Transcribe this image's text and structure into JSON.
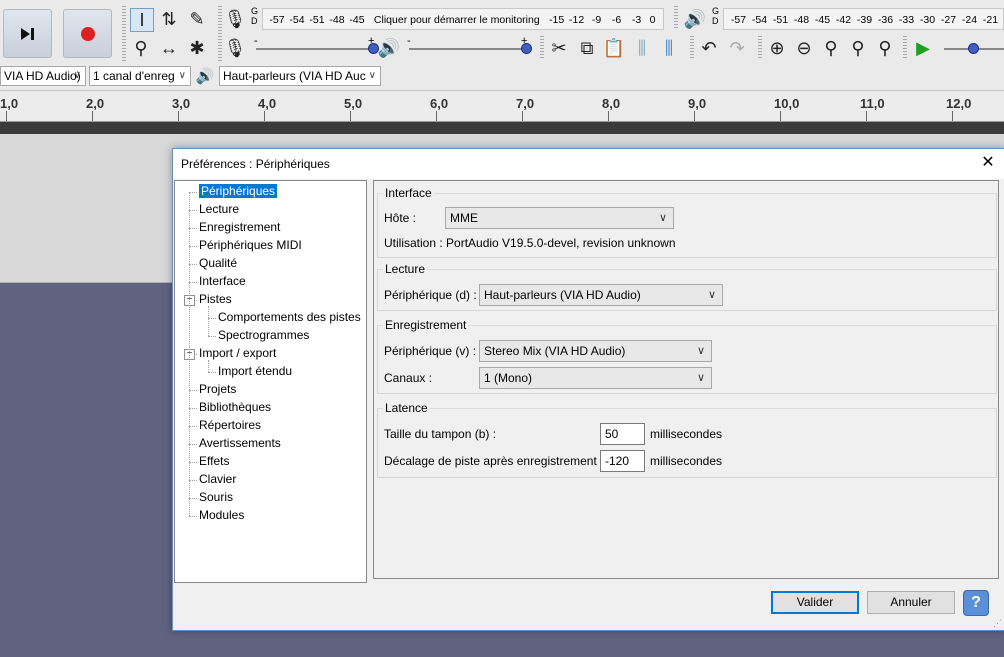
{
  "toolbar": {
    "meter_record_ticks": [
      "-57",
      "-54",
      "-51",
      "-48",
      "-45"
    ],
    "meter_record_prompt": "Cliquer pour démarrer le monitoring",
    "meter_record_ticks_right": [
      "-15",
      "-12",
      "-9",
      "-6",
      "-3",
      "0"
    ],
    "meter_play_ticks": [
      "-57",
      "-54",
      "-51",
      "-48",
      "-45",
      "-42",
      "-39",
      "-36",
      "-33",
      "-30",
      "-27",
      "-24",
      "-21"
    ],
    "meter_lr": [
      "G",
      "D"
    ],
    "slider_minus": "-",
    "slider_plus": "+",
    "host_device": "VIA HD Audio)",
    "channels": "1 canal d'enreg",
    "playback_device": "Haut-parleurs (VIA HD Auc"
  },
  "ruler": {
    "labels": [
      "1,0",
      "2,0",
      "3,0",
      "4,0",
      "5,0",
      "6,0",
      "7,0",
      "8,0",
      "9,0",
      "10,0",
      "11,0",
      "12,0"
    ]
  },
  "dialog": {
    "title": "Préférences : Périphériques",
    "close_glyph": "✕",
    "tree": [
      {
        "label": "Périphériques",
        "level": 0,
        "selected": true
      },
      {
        "label": "Lecture",
        "level": 0
      },
      {
        "label": "Enregistrement",
        "level": 0
      },
      {
        "label": "Périphériques MIDI",
        "level": 0
      },
      {
        "label": "Qualité",
        "level": 0
      },
      {
        "label": "Interface",
        "level": 0
      },
      {
        "label": "Pistes",
        "level": 0,
        "expander": "−"
      },
      {
        "label": "Comportements des pistes",
        "level": 1
      },
      {
        "label": "Spectrogrammes",
        "level": 1
      },
      {
        "label": "Import / export",
        "level": 0,
        "expander": "−"
      },
      {
        "label": "Import étendu",
        "level": 1
      },
      {
        "label": "Projets",
        "level": 0
      },
      {
        "label": "Bibliothèques",
        "level": 0
      },
      {
        "label": "Répertoires",
        "level": 0
      },
      {
        "label": "Avertissements",
        "level": 0
      },
      {
        "label": "Effets",
        "level": 0
      },
      {
        "label": "Clavier",
        "level": 0
      },
      {
        "label": "Souris",
        "level": 0
      },
      {
        "label": "Modules",
        "level": 0
      }
    ],
    "interface": {
      "title": "Interface",
      "host_label": "Hôte :",
      "host_value": "MME",
      "usage": "Utilisation : PortAudio V19.5.0-devel, revision unknown"
    },
    "playback": {
      "title": "Lecture",
      "device_label": "Périphérique (d) :",
      "device_value": "Haut-parleurs (VIA HD Audio)"
    },
    "recording": {
      "title": "Enregistrement",
      "device_label": "Périphérique (v) :",
      "device_value": "Stereo Mix (VIA HD Audio)",
      "channels_label": "Canaux :",
      "channels_value": "1 (Mono)"
    },
    "latency": {
      "title": "Latence",
      "buffer_label": "Taille du tampon (b) :",
      "buffer_value": "50",
      "buffer_unit": "millisecondes",
      "offset_label": "Décalage de piste après enregistrement :",
      "offset_value": "-120",
      "offset_unit": "millisecondes"
    },
    "buttons": {
      "ok": "Valider",
      "cancel": "Annuler",
      "help": "?"
    }
  },
  "colors": {
    "selection": "#0078d7",
    "background": "#5f6380",
    "record": "#e02020",
    "play_green": "#20a020"
  }
}
